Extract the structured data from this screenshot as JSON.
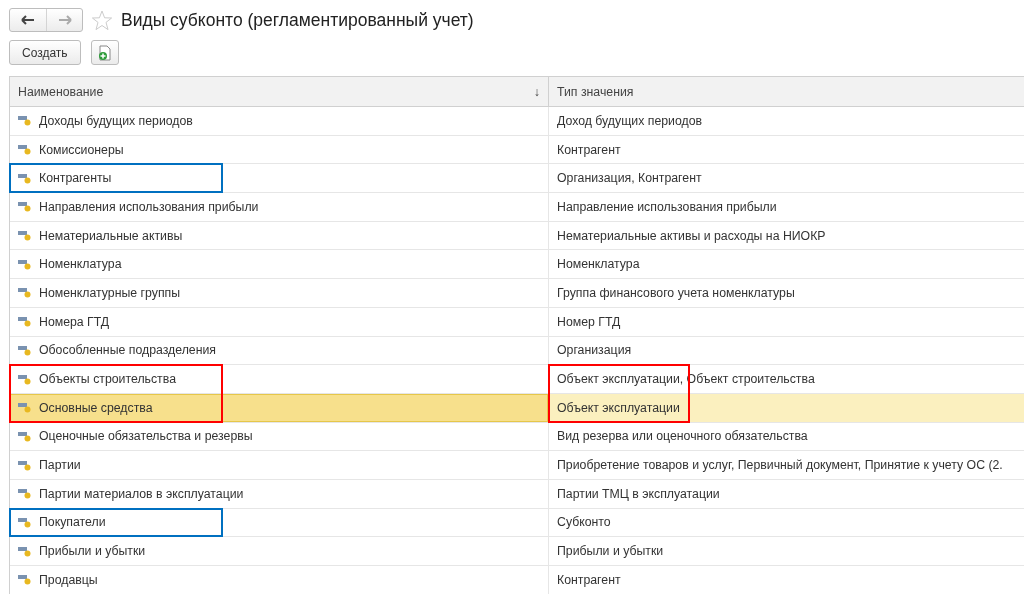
{
  "window": {
    "title": "Виды субконто (регламентированный учет)",
    "favorite": false
  },
  "toolbar": {
    "create_button": "Создать"
  },
  "table": {
    "columns": [
      {
        "label": "Наименование",
        "sort_arrow": "↓"
      },
      {
        "label": "Тип значения"
      }
    ],
    "rows": [
      {
        "name": "Доходы будущих периодов",
        "value": "Доход будущих периодов",
        "selected": false
      },
      {
        "name": "Комиссионеры",
        "value": "Контрагент",
        "selected": false
      },
      {
        "name": "Контрагенты",
        "value": "Организация, Контрагент",
        "selected": false,
        "name_frame": {
          "color": "#0070c0"
        }
      },
      {
        "name": "Направления использования прибыли",
        "value": "Направление использования прибыли",
        "selected": false
      },
      {
        "name": "Нематериальные активы",
        "value": "Нематериальные активы и расходы на НИОКР",
        "selected": false
      },
      {
        "name": "Номенклатура",
        "value": "Номенклатура",
        "selected": false
      },
      {
        "name": "Номенклатурные группы",
        "value": "Группа финансового учета номенклатуры",
        "selected": false
      },
      {
        "name": "Номера ГТД",
        "value": "Номер ГТД",
        "selected": false
      },
      {
        "name": "Обособленные подразделения",
        "value": "Организация",
        "selected": false
      },
      {
        "name": "Объекты строительства",
        "value": "Объект эксплуатации, Объект строительства",
        "selected": false,
        "name_frame": {
          "color": "#ff0000"
        },
        "value_frame": {
          "color": "#ff0000"
        }
      },
      {
        "name": "Основные средства",
        "value": "Объект эксплуатации",
        "selected": true,
        "name_frame": {
          "color": "#ff0000"
        },
        "value_frame": {
          "color": "#ff0000"
        }
      },
      {
        "name": "Оценочные обязательства и резервы",
        "value": "Вид резерва или оценочного обязательства",
        "selected": false
      },
      {
        "name": "Партии",
        "value": "Приобретение товаров и услуг, Первичный документ, Принятие к учету ОС (2.",
        "selected": false
      },
      {
        "name": "Партии материалов в эксплуатации",
        "value": "Партии ТМЦ в эксплуатации",
        "selected": false
      },
      {
        "name": "Покупатели",
        "value": "Субконто",
        "selected": false,
        "name_frame": {
          "color": "#0070c0"
        }
      },
      {
        "name": "Прибыли и убытки",
        "value": "Прибыли и убытки",
        "selected": false
      },
      {
        "name": "Продавцы",
        "value": "Контрагент",
        "selected": false
      }
    ]
  }
}
